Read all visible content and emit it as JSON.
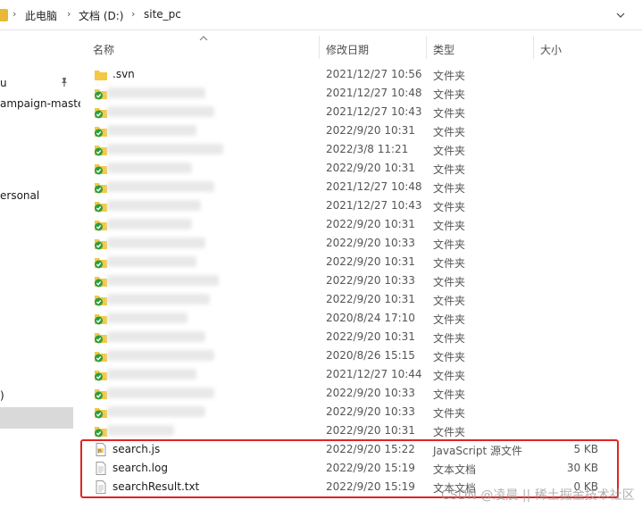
{
  "address_bar": {
    "crumbs": [
      "此电脑",
      "文档 (D:)",
      "site_pc"
    ]
  },
  "sidebar": {
    "items": [
      "u",
      "ampaign-maste",
      "ersonal",
      ")"
    ]
  },
  "columns": {
    "name": "名称",
    "modified": "修改日期",
    "type": "类型",
    "size": "大小"
  },
  "rows": [
    {
      "name": ".svn",
      "modified": "2021/12/27 10:56",
      "type": "文件夹",
      "size": "",
      "icon": "folder-icon"
    },
    {
      "name": "",
      "modified": "2021/12/27 10:48",
      "type": "文件夹",
      "size": "",
      "icon": "svn-folder-icon"
    },
    {
      "name": "",
      "modified": "2021/12/27 10:43",
      "type": "文件夹",
      "size": "",
      "icon": "svn-folder-icon"
    },
    {
      "name": "",
      "modified": "2022/9/20 10:31",
      "type": "文件夹",
      "size": "",
      "icon": "svn-folder-icon"
    },
    {
      "name": "",
      "modified": "2022/3/8 11:21",
      "type": "文件夹",
      "size": "",
      "icon": "svn-folder-icon"
    },
    {
      "name": "",
      "modified": "2022/9/20 10:31",
      "type": "文件夹",
      "size": "",
      "icon": "svn-folder-icon"
    },
    {
      "name": "",
      "modified": "2021/12/27 10:48",
      "type": "文件夹",
      "size": "",
      "icon": "svn-folder-icon"
    },
    {
      "name": "",
      "modified": "2021/12/27 10:43",
      "type": "文件夹",
      "size": "",
      "icon": "svn-folder-icon"
    },
    {
      "name": "",
      "modified": "2022/9/20 10:31",
      "type": "文件夹",
      "size": "",
      "icon": "svn-folder-icon"
    },
    {
      "name": "",
      "modified": "2022/9/20 10:33",
      "type": "文件夹",
      "size": "",
      "icon": "svn-folder-icon"
    },
    {
      "name": "",
      "modified": "2022/9/20 10:31",
      "type": "文件夹",
      "size": "",
      "icon": "svn-folder-icon"
    },
    {
      "name": "",
      "modified": "2022/9/20 10:33",
      "type": "文件夹",
      "size": "",
      "icon": "svn-folder-icon"
    },
    {
      "name": "",
      "modified": "2022/9/20 10:31",
      "type": "文件夹",
      "size": "",
      "icon": "svn-folder-icon"
    },
    {
      "name": "",
      "modified": "2020/8/24 17:10",
      "type": "文件夹",
      "size": "",
      "icon": "svn-folder-icon"
    },
    {
      "name": "",
      "modified": "2022/9/20 10:31",
      "type": "文件夹",
      "size": "",
      "icon": "svn-folder-icon"
    },
    {
      "name": "",
      "modified": "2020/8/26 15:15",
      "type": "文件夹",
      "size": "",
      "icon": "svn-folder-icon"
    },
    {
      "name": "",
      "modified": "2021/12/27 10:44",
      "type": "文件夹",
      "size": "",
      "icon": "svn-folder-icon"
    },
    {
      "name": "",
      "modified": "2022/9/20 10:33",
      "type": "文件夹",
      "size": "",
      "icon": "svn-folder-icon"
    },
    {
      "name": "",
      "modified": "2022/9/20 10:33",
      "type": "文件夹",
      "size": "",
      "icon": "svn-folder-icon"
    },
    {
      "name": "",
      "modified": "2022/9/20 10:31",
      "type": "文件夹",
      "size": "",
      "icon": "svn-folder-icon"
    },
    {
      "name": "search.js",
      "modified": "2022/9/20 15:22",
      "type": "JavaScript 源文件",
      "size": "5 KB",
      "icon": "js-file-icon"
    },
    {
      "name": "search.log",
      "modified": "2022/9/20 15:19",
      "type": "文本文档",
      "size": "30 KB",
      "icon": "text-file-icon"
    },
    {
      "name": "searchResult.txt",
      "modified": "2022/9/20 15:19",
      "type": "文本文档",
      "size": "0 KB",
      "icon": "text-file-icon"
    }
  ],
  "watermark": "CSDN @凌晨 || 稀土掘金技术社区",
  "colors": {
    "folder": "#f3c846",
    "svn_check": "#2e9e3a",
    "highlight": "#e02424"
  }
}
